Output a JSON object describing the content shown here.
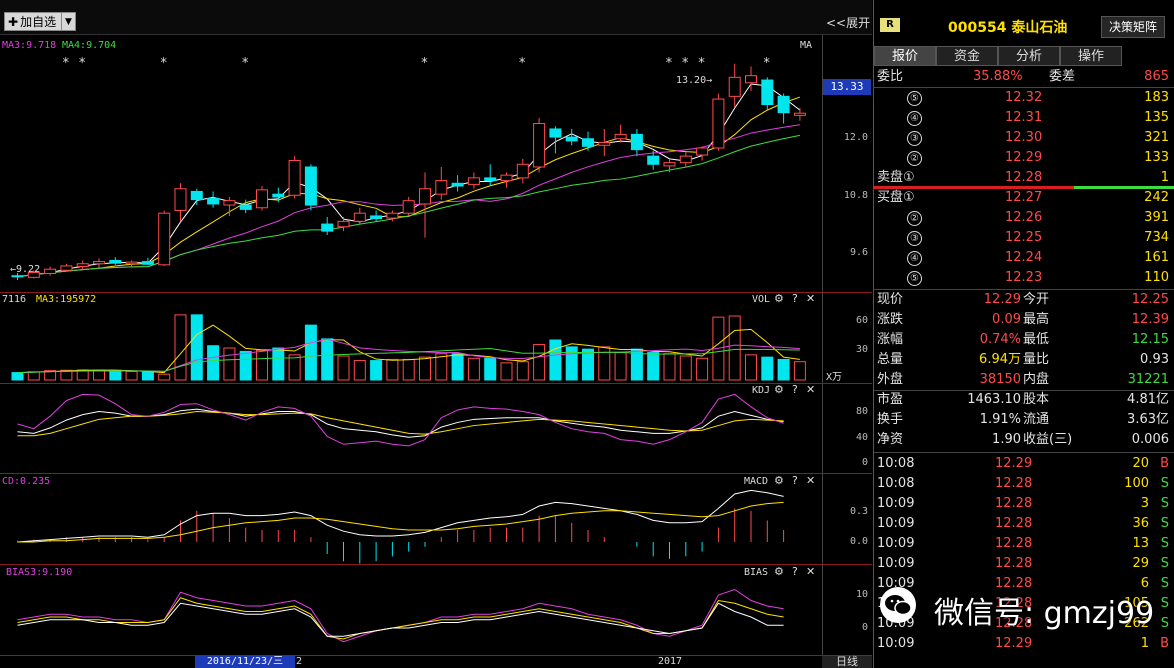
{
  "toolbar": {
    "add_label": "加自选",
    "expand_label": "<<展开"
  },
  "main_panel": {
    "ma3_label": "MA3:9.718",
    "ma4_label": "MA4:9.704",
    "type_label": "MA",
    "current_price_tag": "13.33",
    "high_annot": "13.20→",
    "low_annot": "←9.22",
    "y_ticks": [
      "12.0",
      "10.8",
      "9.6"
    ],
    "star_glyph": "*"
  },
  "vol_panel": {
    "left_label": "7116",
    "ma3_label": "MA3:195972",
    "name": "VOL",
    "y_ticks": [
      "60",
      "30"
    ],
    "unit": "X万"
  },
  "kdj_panel": {
    "name": "KDJ",
    "y_ticks": [
      "80",
      "40",
      "0"
    ]
  },
  "macd_panel": {
    "left_label": "CD:0.235",
    "name": "MACD",
    "y_ticks": [
      "0.3",
      "0.0"
    ]
  },
  "bias_panel": {
    "left_label": "BIAS3:9.190",
    "name": "BIAS",
    "y_ticks": [
      "10",
      "0"
    ]
  },
  "date_bar": {
    "highlight": "2016/11/23/三",
    "after": "2",
    "year": "2017",
    "period": "日线"
  },
  "panel_icons": {
    "gear": "⚙",
    "help": "?",
    "close": "✕"
  },
  "header": {
    "badge": "R",
    "code_name": "000554 泰山石油",
    "decision_btn": "决策矩阵"
  },
  "tabs": [
    "报价",
    "资金",
    "分析",
    "操作"
  ],
  "committee": {
    "ratio_label": "委比",
    "ratio": "35.88%",
    "diff_label": "委差",
    "diff": "865"
  },
  "sell_label": "卖盘①",
  "buy_label": "买盘①",
  "asks": [
    {
      "idx": "⑤",
      "price": "12.32",
      "vol": "183"
    },
    {
      "idx": "④",
      "price": "12.31",
      "vol": "135"
    },
    {
      "idx": "③",
      "price": "12.30",
      "vol": "321"
    },
    {
      "idx": "②",
      "price": "12.29",
      "vol": "133"
    },
    {
      "idx": "①",
      "price": "12.28",
      "vol": "1"
    }
  ],
  "bids": [
    {
      "idx": "①",
      "price": "12.27",
      "vol": "242"
    },
    {
      "idx": "②",
      "price": "12.26",
      "vol": "391"
    },
    {
      "idx": "③",
      "price": "12.25",
      "vol": "734"
    },
    {
      "idx": "④",
      "price": "12.24",
      "vol": "161"
    },
    {
      "idx": "⑤",
      "price": "12.23",
      "vol": "110"
    }
  ],
  "quote": [
    {
      "l1": "现价",
      "v1": "12.29",
      "l2": "今开",
      "v2": "12.25"
    },
    {
      "l1": "涨跌",
      "v1": "0.09",
      "l2": "最高",
      "v2": "12.39"
    },
    {
      "l1": "涨幅",
      "v1": "0.74%",
      "l2": "最低",
      "v2": "12.15"
    },
    {
      "l1": "总量",
      "v1": "6.94万",
      "l2": "量比",
      "v2": "0.93"
    },
    {
      "l1": "外盘",
      "v1": "38150",
      "l2": "内盘",
      "v2": "31221"
    }
  ],
  "fund": [
    {
      "l1": "市盈",
      "v1": "1463.10",
      "l2": "股本",
      "v2": "4.81亿"
    },
    {
      "l1": "换手",
      "v1": "1.91%",
      "l2": "流通",
      "v2": "3.63亿"
    },
    {
      "l1": "净资",
      "v1": "1.90",
      "l2": "收益(三)",
      "v2": "0.006"
    }
  ],
  "ticks": [
    {
      "time": "10:08",
      "price": "12.29",
      "vol": "20",
      "side": "B"
    },
    {
      "time": "10:08",
      "price": "12.28",
      "vol": "100",
      "side": "S"
    },
    {
      "time": "10:09",
      "price": "12.28",
      "vol": "3",
      "side": "S"
    },
    {
      "time": "10:09",
      "price": "12.28",
      "vol": "36",
      "side": "S"
    },
    {
      "time": "10:09",
      "price": "12.28",
      "vol": "13",
      "side": "S"
    },
    {
      "time": "10:09",
      "price": "12.28",
      "vol": "29",
      "side": "S"
    },
    {
      "time": "10:09",
      "price": "12.28",
      "vol": "6",
      "side": "S"
    },
    {
      "time": "10:09",
      "price": "12.28",
      "vol": "105",
      "side": "S"
    },
    {
      "time": "10:09",
      "price": "12.28",
      "vol": "262",
      "side": "S"
    },
    {
      "time": "10:09",
      "price": "12.29",
      "vol": "1",
      "side": "B"
    }
  ],
  "watermark": "微信号: gmzj99",
  "colors": {
    "up": "#ff4a4a",
    "down": "#00e5ee",
    "yellow": "#ffe100",
    "green": "#3fdc3f",
    "magenta": "#e040e0",
    "white": "#ffffff",
    "highlight": "#1d3ab8"
  },
  "chart_data": {
    "type": "candlestick",
    "candles": [
      {
        "o": 9.3,
        "h": 9.35,
        "l": 9.22,
        "c": 9.28
      },
      {
        "o": 9.27,
        "h": 9.4,
        "l": 9.25,
        "c": 9.36
      },
      {
        "o": 9.34,
        "h": 9.47,
        "l": 9.3,
        "c": 9.42
      },
      {
        "o": 9.4,
        "h": 9.52,
        "l": 9.38,
        "c": 9.48
      },
      {
        "o": 9.47,
        "h": 9.58,
        "l": 9.42,
        "c": 9.52
      },
      {
        "o": 9.52,
        "h": 9.62,
        "l": 9.45,
        "c": 9.56
      },
      {
        "o": 9.58,
        "h": 9.64,
        "l": 9.5,
        "c": 9.53
      },
      {
        "o": 9.52,
        "h": 9.58,
        "l": 9.46,
        "c": 9.55
      },
      {
        "o": 9.56,
        "h": 9.63,
        "l": 9.5,
        "c": 9.51
      },
      {
        "o": 9.5,
        "h": 10.5,
        "l": 9.48,
        "c": 10.45
      },
      {
        "o": 10.5,
        "h": 11.0,
        "l": 10.3,
        "c": 10.9
      },
      {
        "o": 10.85,
        "h": 10.9,
        "l": 10.6,
        "c": 10.7
      },
      {
        "o": 10.72,
        "h": 10.85,
        "l": 10.55,
        "c": 10.62
      },
      {
        "o": 10.6,
        "h": 10.75,
        "l": 10.4,
        "c": 10.68
      },
      {
        "o": 10.6,
        "h": 10.7,
        "l": 10.45,
        "c": 10.52
      },
      {
        "o": 10.55,
        "h": 10.95,
        "l": 10.5,
        "c": 10.88
      },
      {
        "o": 10.8,
        "h": 10.92,
        "l": 10.65,
        "c": 10.75
      },
      {
        "o": 10.78,
        "h": 11.5,
        "l": 10.72,
        "c": 11.42
      },
      {
        "o": 11.3,
        "h": 11.35,
        "l": 10.5,
        "c": 10.6
      },
      {
        "o": 10.25,
        "h": 10.38,
        "l": 10.05,
        "c": 10.12
      },
      {
        "o": 10.2,
        "h": 10.38,
        "l": 10.12,
        "c": 10.3
      },
      {
        "o": 10.3,
        "h": 10.55,
        "l": 10.25,
        "c": 10.45
      },
      {
        "o": 10.4,
        "h": 10.5,
        "l": 10.3,
        "c": 10.35
      },
      {
        "o": 10.36,
        "h": 10.5,
        "l": 10.3,
        "c": 10.45
      },
      {
        "o": 10.45,
        "h": 10.75,
        "l": 10.4,
        "c": 10.68
      },
      {
        "o": 10.62,
        "h": 11.2,
        "l": 10.0,
        "c": 10.9
      },
      {
        "o": 10.8,
        "h": 11.3,
        "l": 10.7,
        "c": 11.05
      },
      {
        "o": 11.0,
        "h": 11.15,
        "l": 10.85,
        "c": 10.95
      },
      {
        "o": 10.98,
        "h": 11.2,
        "l": 10.9,
        "c": 11.1
      },
      {
        "o": 11.1,
        "h": 11.35,
        "l": 10.95,
        "c": 11.05
      },
      {
        "o": 11.05,
        "h": 11.2,
        "l": 10.92,
        "c": 11.15
      },
      {
        "o": 11.1,
        "h": 11.45,
        "l": 11.0,
        "c": 11.35
      },
      {
        "o": 11.3,
        "h": 12.2,
        "l": 11.2,
        "c": 12.1
      },
      {
        "o": 12.0,
        "h": 12.05,
        "l": 11.55,
        "c": 11.85
      },
      {
        "o": 11.85,
        "h": 12.0,
        "l": 11.7,
        "c": 11.78
      },
      {
        "o": 11.82,
        "h": 11.95,
        "l": 11.6,
        "c": 11.68
      },
      {
        "o": 11.7,
        "h": 12.0,
        "l": 11.5,
        "c": 11.75
      },
      {
        "o": 11.82,
        "h": 12.08,
        "l": 11.75,
        "c": 11.9
      },
      {
        "o": 11.9,
        "h": 12.0,
        "l": 11.5,
        "c": 11.62
      },
      {
        "o": 11.5,
        "h": 11.6,
        "l": 11.25,
        "c": 11.35
      },
      {
        "o": 11.32,
        "h": 11.45,
        "l": 11.2,
        "c": 11.38
      },
      {
        "o": 11.38,
        "h": 11.58,
        "l": 11.3,
        "c": 11.5
      },
      {
        "o": 11.52,
        "h": 11.68,
        "l": 11.42,
        "c": 11.65
      },
      {
        "o": 11.65,
        "h": 12.65,
        "l": 11.6,
        "c": 12.55
      },
      {
        "o": 12.6,
        "h": 13.2,
        "l": 12.4,
        "c": 12.95
      },
      {
        "o": 12.85,
        "h": 13.15,
        "l": 12.7,
        "c": 12.98
      },
      {
        "o": 12.9,
        "h": 12.95,
        "l": 12.35,
        "c": 12.45
      },
      {
        "o": 12.6,
        "h": 12.65,
        "l": 12.1,
        "c": 12.3
      },
      {
        "o": 12.25,
        "h": 12.39,
        "l": 12.15,
        "c": 12.29
      }
    ],
    "vol": [
      6.5,
      7.2,
      8.2,
      8.5,
      8.8,
      8.6,
      8.4,
      7.4,
      7.0,
      5.1,
      57,
      57,
      30,
      28,
      25,
      26,
      28,
      22,
      48,
      36,
      21,
      17,
      17,
      18,
      18,
      20,
      23,
      23,
      19,
      19,
      15,
      16,
      31,
      35,
      29,
      27,
      29,
      24,
      27,
      24,
      23,
      21,
      19,
      55,
      56,
      22,
      20,
      18,
      16
    ],
    "kdj": {
      "k": [
        40,
        38,
        45,
        55,
        62,
        66,
        64,
        60,
        60,
        62,
        67,
        69,
        66,
        64,
        60,
        63,
        66,
        66,
        62,
        50,
        44,
        42,
        40,
        36,
        33,
        35,
        46,
        52,
        56,
        57,
        58,
        58,
        58,
        54,
        51,
        48,
        46,
        42,
        40,
        38,
        38,
        41,
        45,
        60,
        66,
        61,
        56,
        53
      ],
      "d": [
        35,
        35,
        38,
        44,
        50,
        56,
        58,
        60,
        60,
        61,
        63,
        66,
        65,
        64,
        62,
        62,
        63,
        64,
        63,
        58,
        54,
        50,
        46,
        42,
        38,
        37,
        40,
        44,
        48,
        50,
        52,
        54,
        56,
        55,
        54,
        52,
        50,
        48,
        46,
        44,
        42,
        41,
        42,
        48,
        54,
        56,
        55,
        54
      ],
      "j": [
        50,
        44,
        60,
        80,
        88,
        87,
        76,
        62,
        60,
        65,
        75,
        76,
        68,
        62,
        55,
        65,
        72,
        70,
        60,
        34,
        24,
        26,
        28,
        24,
        22,
        30,
        58,
        68,
        72,
        70,
        69,
        66,
        62,
        52,
        44,
        40,
        38,
        30,
        28,
        24,
        30,
        40,
        52,
        82,
        88,
        72,
        58,
        51
      ]
    },
    "macd": {
      "dif": [
        0.0,
        0.01,
        0.02,
        0.03,
        0.04,
        0.05,
        0.05,
        0.05,
        0.04,
        0.06,
        0.15,
        0.22,
        0.24,
        0.24,
        0.22,
        0.22,
        0.23,
        0.25,
        0.22,
        0.14,
        0.09,
        0.06,
        0.05,
        0.05,
        0.06,
        0.08,
        0.12,
        0.16,
        0.18,
        0.2,
        0.21,
        0.23,
        0.3,
        0.33,
        0.32,
        0.3,
        0.28,
        0.26,
        0.23,
        0.18,
        0.16,
        0.16,
        0.17,
        0.28,
        0.4,
        0.43,
        0.41,
        0.38
      ],
      "dea": [
        0.0,
        0.0,
        0.01,
        0.01,
        0.02,
        0.03,
        0.03,
        0.03,
        0.03,
        0.04,
        0.06,
        0.09,
        0.12,
        0.14,
        0.16,
        0.17,
        0.18,
        0.2,
        0.2,
        0.19,
        0.17,
        0.15,
        0.13,
        0.11,
        0.1,
        0.1,
        0.1,
        0.11,
        0.13,
        0.14,
        0.15,
        0.17,
        0.19,
        0.22,
        0.24,
        0.25,
        0.26,
        0.26,
        0.25,
        0.24,
        0.23,
        0.22,
        0.21,
        0.22,
        0.26,
        0.3,
        0.32,
        0.33
      ],
      "bar": [
        0.01,
        0.02,
        0.02,
        0.04,
        0.04,
        0.04,
        0.04,
        0.04,
        0.02,
        0.04,
        0.18,
        0.26,
        0.24,
        0.2,
        0.12,
        0.1,
        0.1,
        0.1,
        0.04,
        -0.1,
        -0.16,
        -0.18,
        -0.16,
        -0.12,
        -0.08,
        -0.04,
        0.04,
        0.1,
        0.1,
        0.12,
        0.12,
        0.12,
        0.22,
        0.22,
        0.16,
        0.1,
        0.04,
        0.0,
        -0.04,
        -0.12,
        -0.14,
        -0.12,
        -0.08,
        0.12,
        0.28,
        0.26,
        0.18,
        0.1
      ]
    },
    "bias": {
      "b1": [
        3,
        4,
        5,
        5,
        4,
        4,
        3,
        3,
        2,
        3,
        13,
        11,
        10,
        9,
        8,
        8,
        9,
        10,
        7,
        -2,
        -5,
        -3,
        -1,
        0,
        1,
        2,
        4,
        4,
        5,
        5,
        6,
        7,
        9,
        8,
        7,
        5,
        4,
        3,
        1,
        -2,
        -3,
        -1,
        1,
        12,
        14,
        10,
        8,
        7
      ],
      "b2": [
        2,
        3,
        4,
        4,
        3,
        3,
        2,
        2,
        2,
        3,
        11,
        9,
        8,
        7,
        6,
        6,
        7,
        8,
        5,
        -3,
        -4,
        -2,
        -1,
        0,
        1,
        2,
        3,
        3,
        4,
        4,
        5,
        6,
        7,
        6,
        5,
        4,
        3,
        2,
        0,
        -2,
        -2,
        -1,
        0,
        10,
        9,
        7,
        5,
        4
      ],
      "b3": [
        1,
        2,
        3,
        3,
        3,
        2,
        2,
        1,
        1,
        2,
        9,
        8,
        7,
        6,
        5,
        5,
        6,
        7,
        4,
        -3,
        -3,
        -2,
        -1,
        0,
        0,
        1,
        2,
        2,
        3,
        3,
        4,
        5,
        6,
        5,
        4,
        3,
        2,
        1,
        0,
        -1,
        -2,
        -1,
        0,
        9,
        6,
        4,
        1,
        1
      ]
    },
    "stars_at": [
      3,
      4,
      9,
      14,
      25,
      31,
      40,
      41,
      42,
      46
    ]
  }
}
